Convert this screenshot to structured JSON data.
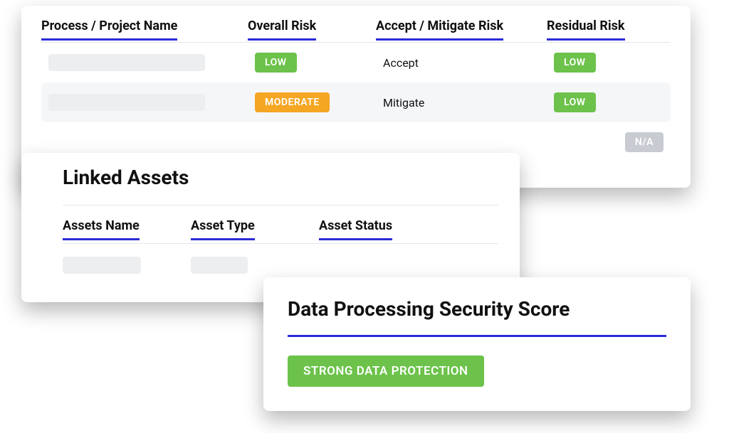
{
  "risk_table": {
    "headers": {
      "name": "Process / Project Name",
      "overall": "Overall Risk",
      "action": "Accept / Mitigate Risk",
      "residual": "Residual Risk"
    },
    "rows": [
      {
        "overall": "LOW",
        "action": "Accept",
        "residual": "LOW"
      },
      {
        "overall": "MODERATE",
        "action": "Mitigate",
        "residual": "LOW"
      }
    ],
    "na_badge": "N/A"
  },
  "assets_card": {
    "title": "Linked Assets",
    "headers": {
      "name": "Assets Name",
      "type": "Asset Type",
      "status": "Asset Status"
    }
  },
  "score_card": {
    "title": "Data Processing Security Score",
    "badge": "STRONG DATA PROTECTION"
  },
  "colors": {
    "accent": "#2b2bd8",
    "green": "#6cc24a",
    "orange": "#f5a623",
    "grey": "#c8cbd1"
  }
}
